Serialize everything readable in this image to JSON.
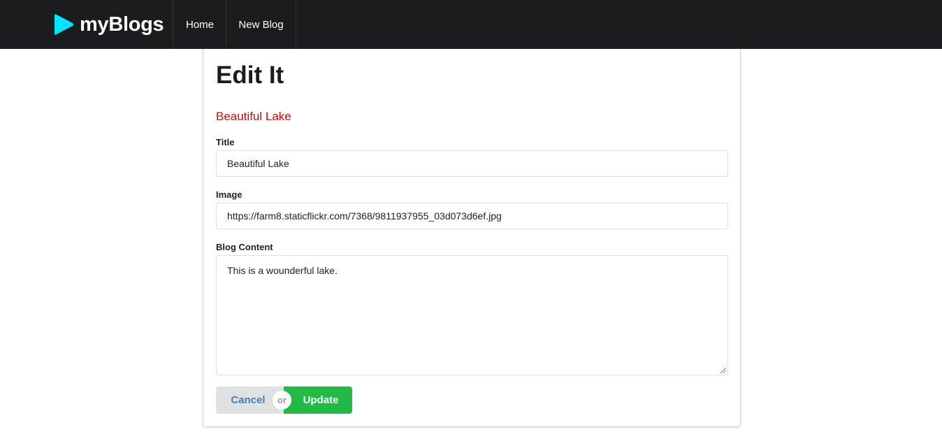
{
  "nav": {
    "brand": "myBlogs",
    "brand_icon": "play-icon",
    "brand_icon_color": "#00e5ff",
    "items": [
      {
        "label": "Home"
      },
      {
        "label": "New Blog"
      }
    ]
  },
  "form": {
    "heading": "Edit It",
    "post_title": "Beautiful Lake",
    "post_title_color": "#e00000",
    "title_label": "Title",
    "title_value": "Beautiful Lake",
    "image_label": "Image",
    "image_value": "https://farm8.staticflickr.com/7368/9811937955_03d073d6ef.jpg",
    "content_label": "Blog Content",
    "content_value": "This is a wounderful lake.",
    "cancel_label": "Cancel",
    "or_label": "or",
    "update_label": "Update",
    "update_color": "#21ba45"
  }
}
